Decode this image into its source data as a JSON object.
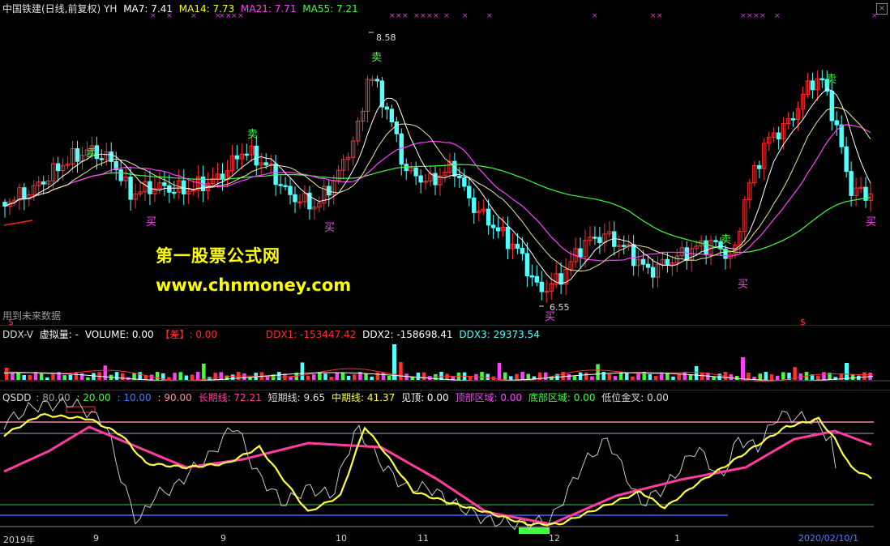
{
  "main_header": {
    "title": "中国铁建(日线,前复权) YH",
    "ma7": "MA7: 7.41",
    "ma14": "MA14: 7.73",
    "ma21": "MA21: 7.71",
    "ma55": "MA55: 7.21"
  },
  "watermark": {
    "line1": "第一股票公式网",
    "line2": "www.chnmoney.com"
  },
  "future_data_note": "用到未来数据",
  "price_labels": {
    "high": "8.58",
    "low": "6.55"
  },
  "signals": {
    "buy": "买",
    "sell": "卖"
  },
  "ddx_header": {
    "name": "DDX-V",
    "virtual_vol": "虚拟量: -",
    "volume": "VOLUME: 0.00",
    "diff": "【差】: 0.00",
    "ddx1": "DDX1: -153447.42",
    "ddx2": "DDX2: -158698.41",
    "ddx3": "DDX3: 29373.54"
  },
  "qsdd_header": {
    "name": "QSDD",
    "l80": ": 80.00",
    "l20": ": 20.00",
    "l10": ": 10.00",
    "l90": ": 90.00",
    "long": "长期线: 72.21",
    "short": "短期线: 9.65",
    "mid": "中期线: 41.37",
    "jianding": "见顶: 0.00",
    "top_zone": "顶部区域: 0.00",
    "bottom_zone": "底部区域: 0.00",
    "low_cross": "低位金叉: 0.00"
  },
  "dates": [
    "2019年",
    "9",
    "9",
    "10",
    "11",
    "12",
    "1",
    "2020/02/10/1"
  ],
  "colors": {
    "up": "#ff3030",
    "down": "#54ffff",
    "ma7": "#ffffff",
    "ma14": "#ffff00",
    "ma21": "#ff40ff",
    "ma55": "#40ff40",
    "long_line": "#ff3ca0",
    "mid_line": "#ffff40",
    "short_line": "#c8c8c8"
  },
  "chart_data": {
    "type": "candlestick",
    "ylim": [
      6.5,
      8.7
    ],
    "ma_labels": [
      "MA7",
      "MA14",
      "MA21",
      "MA55"
    ]
  }
}
